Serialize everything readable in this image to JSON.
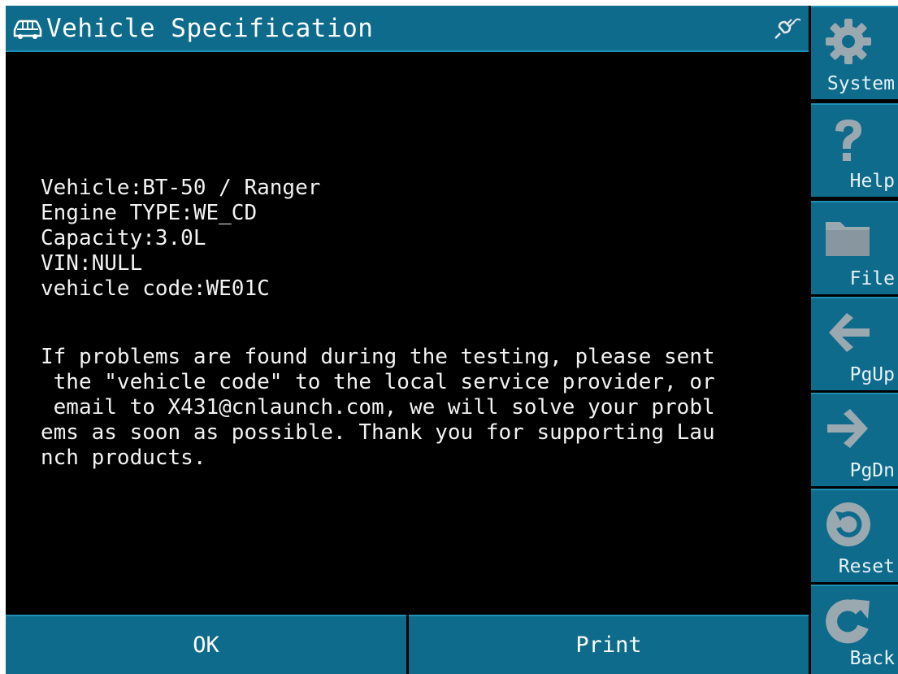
{
  "titlebar": {
    "title": "Vehicle Specification",
    "car_icon": "car-icon",
    "connection_icon": "connection-plug-icon"
  },
  "content": {
    "info_lines": [
      "Vehicle:BT-50 / Ranger",
      "Engine TYPE:WE_CD",
      "Capacity:3.0L",
      "VIN:NULL",
      "vehicle code:WE01C"
    ],
    "message_lines": [
      "If problems are found during the testing, please sent",
      " the \"vehicle code\" to the local service provider, or",
      " email to X431@cnlaunch.com, we will solve your probl",
      "ems as soon as possible. Thank you for supporting Lau",
      "nch products."
    ]
  },
  "buttons": {
    "ok": "OK",
    "print": "Print"
  },
  "sidebar": {
    "items": [
      {
        "label": "System",
        "icon": "gear-icon"
      },
      {
        "label": "Help",
        "icon": "question-icon"
      },
      {
        "label": "File",
        "icon": "folder-icon"
      },
      {
        "label": "PgUp",
        "icon": "arrow-left-icon"
      },
      {
        "label": "PgDn",
        "icon": "arrow-right-icon"
      },
      {
        "label": "Reset",
        "icon": "reset-icon"
      },
      {
        "label": "Back",
        "icon": "back-icon"
      }
    ]
  },
  "colors": {
    "bar": "#0e6b8c",
    "bar_border": "#1d90b5",
    "background": "#000000",
    "text": "#f2f2f2",
    "icon_gray": "#9aa8b0"
  }
}
